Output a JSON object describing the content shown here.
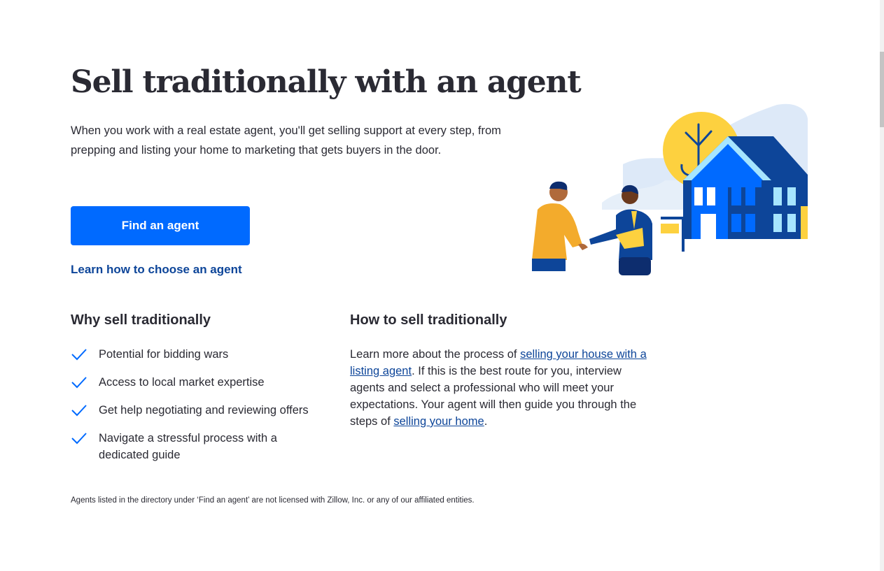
{
  "hero": {
    "title": "Sell traditionally with an agent",
    "description": "When you work with a real estate agent, you'll get selling support at every step, from prepping and listing your home to marketing that gets buyers in the door.",
    "primary_button": "Find an agent",
    "secondary_link": "Learn how to choose an agent",
    "illustration_icon": "agent-handshake-house-illustration"
  },
  "why": {
    "heading": "Why sell traditionally",
    "check_icon": "checkmark-icon",
    "items": [
      "Potential for bidding wars",
      "Access to local market expertise",
      "Get help negotiating and reviewing offers",
      "Navigate a stressful process with a dedicated guide"
    ]
  },
  "how": {
    "heading": "How to sell traditionally",
    "text_1": "Learn more about the process of ",
    "link_1": "selling your house with a listing agent",
    "text_2": ". If this is the best route for you, interview agents and select a professional who will meet your expectations. Your agent will then guide you through the steps of ",
    "link_2": "selling your home",
    "text_3": "."
  },
  "disclaimer": "Agents listed in the directory under ‘Find an agent’ are not licensed with Zillow, Inc. or any of our affiliated entities.",
  "colors": {
    "primary_blue": "#006aff",
    "link_blue": "#0d4599",
    "text_dark": "#2a2a33"
  }
}
